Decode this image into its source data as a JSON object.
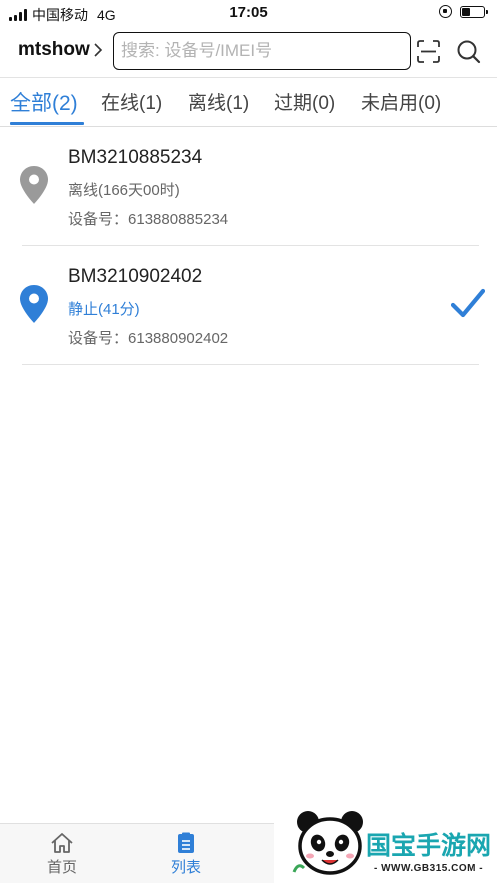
{
  "status_bar": {
    "carrier": "中国移动",
    "network": "4G",
    "time": "17:05",
    "battery_level": 0.4
  },
  "header": {
    "account": "mtshow",
    "search_placeholder": "搜索: 设备号/IMEI号"
  },
  "tabs": [
    {
      "label": "全部(2)",
      "active": true
    },
    {
      "label": "在线(1)",
      "active": false
    },
    {
      "label": "离线(1)",
      "active": false
    },
    {
      "label": "过期(0)",
      "active": false
    },
    {
      "label": "未启用(0)",
      "active": false
    }
  ],
  "devices": [
    {
      "name": "BM3210885234",
      "status": "离线(166天00时)",
      "imei_label": "设备号：",
      "imei": "613880885234",
      "pin_color": "#9a9a9a",
      "selected": false
    },
    {
      "name": "BM3210902402",
      "status": "静止(41分)",
      "imei_label": "设备号：",
      "imei": "613880902402",
      "pin_color": "#2f7fd7",
      "selected": true
    }
  ],
  "bottom_nav": [
    {
      "label": "首页",
      "icon": "home-icon",
      "active": false
    },
    {
      "label": "列表",
      "icon": "list-icon",
      "active": true
    }
  ],
  "watermark": {
    "brand": "国宝手游网",
    "url": "- WWW.GB315.COM -"
  },
  "colors": {
    "accent": "#2f7fd7",
    "offline": "#9a9a9a"
  }
}
